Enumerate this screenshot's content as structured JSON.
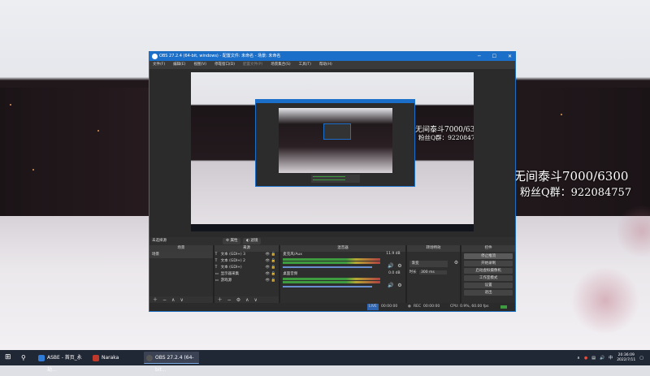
{
  "desktop": {
    "overlay_line1": "无间泰斗7000/6300",
    "overlay_line2": "粉丝Q群：922084757"
  },
  "obs": {
    "title": "OBS 27.2.4 (64-bit, windows) - 配置文件: 未命名 - 场景: 未命名",
    "menu": [
      "文件(F)",
      "编辑(E)",
      "视图(V)",
      "停靠窗口(D)",
      "配置文件(P)",
      "场景集合(S)",
      "工具(T)",
      "帮助(H)"
    ],
    "no_source_label": "未选择源",
    "properties_label": "属性",
    "filters_label": "滤镜",
    "docks": {
      "scenes_header": "场景",
      "scene_item": "场景",
      "sources_header": "来源",
      "sources": [
        {
          "icon": "T",
          "label": "文本 (GDI+) 3"
        },
        {
          "icon": "T",
          "label": "文本 (GDI+) 2"
        },
        {
          "icon": "T",
          "label": "文本 (GDI+)"
        },
        {
          "icon": "▭",
          "label": "显示器采集"
        },
        {
          "icon": "▭",
          "label": "游戏源"
        }
      ],
      "mixer_header": "混音器",
      "mixer": [
        {
          "name": "麦克风/Aux",
          "db": "11.9 dB"
        },
        {
          "name": "桌面音频",
          "db": "0.0 dB"
        }
      ],
      "transitions_header": "转场特效",
      "transition_type": "渐变",
      "duration_label": "时长",
      "duration_value": "300 ms",
      "controls_header": "控件",
      "controls": [
        "停止推流",
        "开始录制",
        "启动虚拟摄像机",
        "工作室模式",
        "设置",
        "退出"
      ]
    },
    "status": {
      "live_badge": "LIVE",
      "live_time": "00:00:00",
      "rec_badge": "REC",
      "rec_time": "00:00:00",
      "cpu": "CPU: 0.9%, 60.00 fps"
    }
  },
  "taskbar": {
    "items": [
      {
        "label": "ASBE - 首页_永劫...",
        "color": "#2f7bd6"
      },
      {
        "label": "Naraka",
        "color": "#c0392b"
      },
      {
        "label": "OBS 27.2.4 (64-bit...",
        "color": "#444444"
      }
    ],
    "time": "20:36:09",
    "date": "2022/7/11"
  }
}
